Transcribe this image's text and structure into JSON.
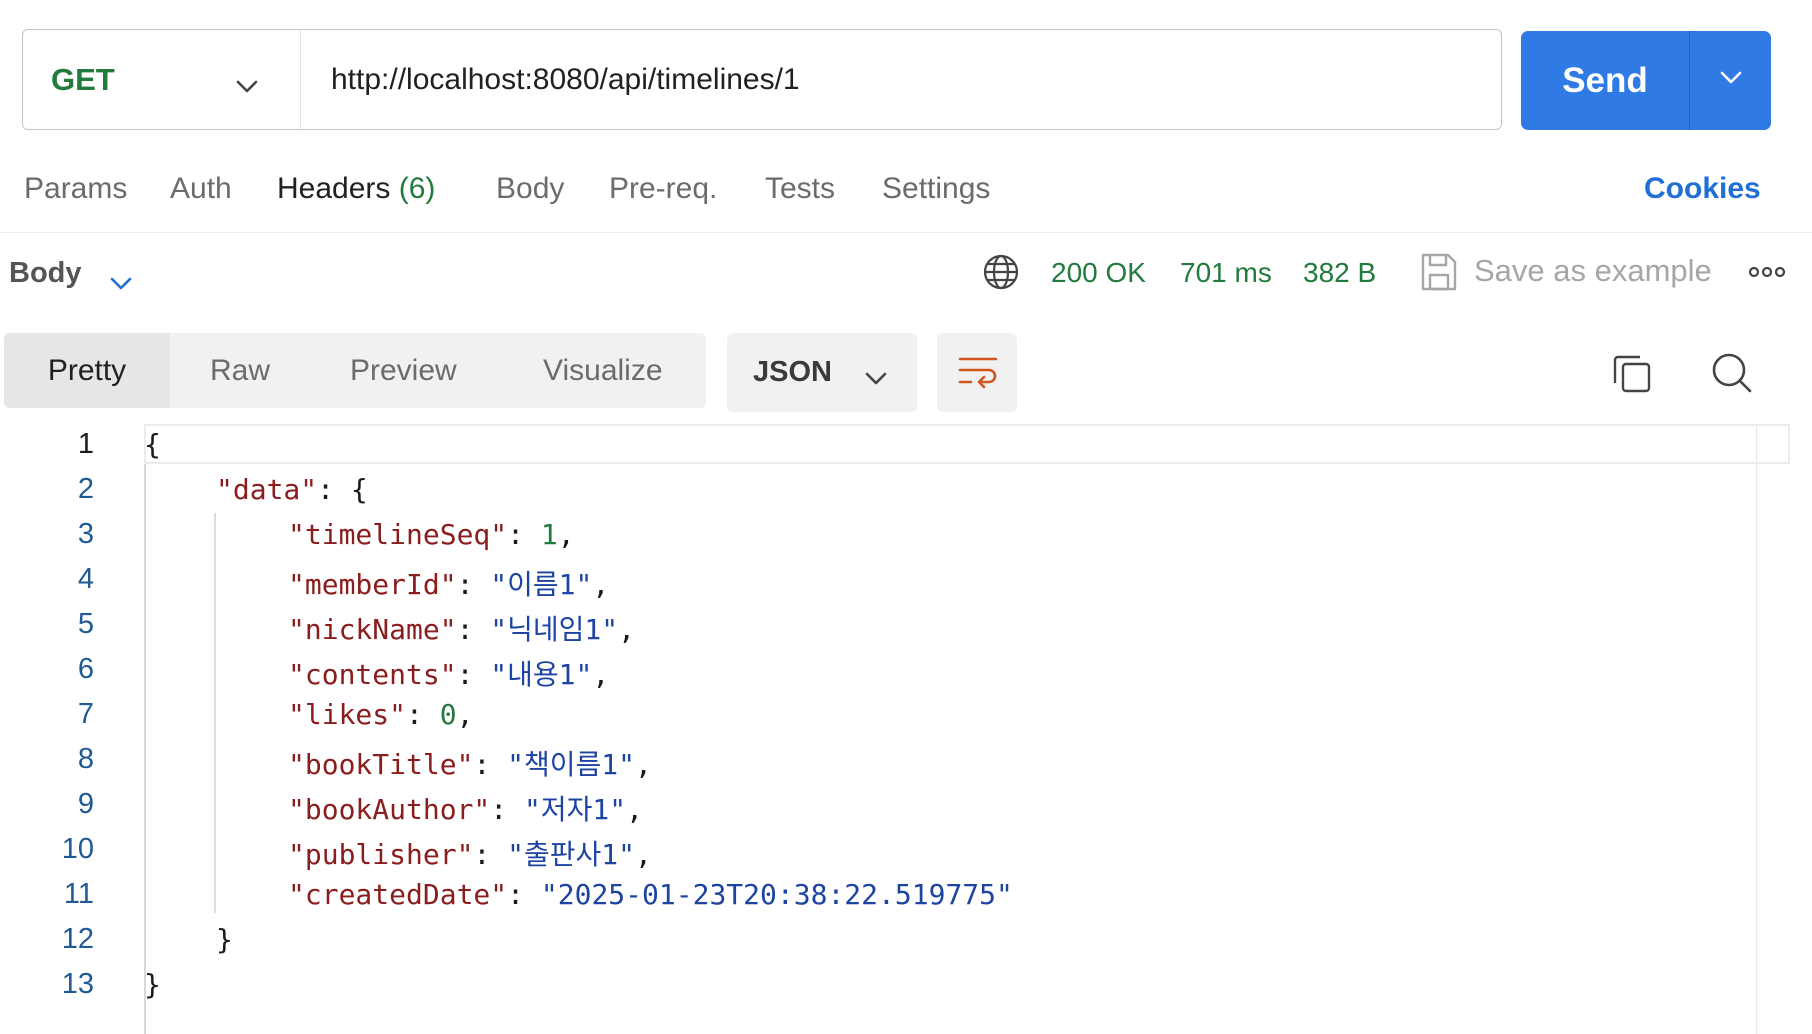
{
  "request": {
    "method": "GET",
    "url": "http://localhost:8080/api/timelines/1",
    "send_label": "Send"
  },
  "tabs": {
    "params": "Params",
    "auth": "Auth",
    "headers": "Headers",
    "headers_count": "(6)",
    "body": "Body",
    "prereq": "Pre-req.",
    "tests": "Tests",
    "settings": "Settings",
    "cookies": "Cookies"
  },
  "response": {
    "section_label": "Body",
    "status": "200 OK",
    "time": "701 ms",
    "size": "382 B",
    "save_example": "Save as example"
  },
  "view": {
    "pretty": "Pretty",
    "raw": "Raw",
    "preview": "Preview",
    "visualize": "Visualize",
    "format": "JSON"
  },
  "code": {
    "line_numbers": [
      "1",
      "2",
      "3",
      "4",
      "5",
      "6",
      "7",
      "8",
      "9",
      "10",
      "11",
      "12",
      "13"
    ],
    "open_brace": "{",
    "data_key": "\"data\"",
    "data_open": ": {",
    "fields": [
      {
        "key": "\"timelineSeq\"",
        "value": "1",
        "type": "number",
        "trail": ","
      },
      {
        "key": "\"memberId\"",
        "value": "\"이름1\"",
        "type": "string",
        "trail": ","
      },
      {
        "key": "\"nickName\"",
        "value": "\"닉네임1\"",
        "type": "string",
        "trail": ","
      },
      {
        "key": "\"contents\"",
        "value": "\"내용1\"",
        "type": "string",
        "trail": ","
      },
      {
        "key": "\"likes\"",
        "value": "0",
        "type": "number",
        "trail": ","
      },
      {
        "key": "\"bookTitle\"",
        "value": "\"책이름1\"",
        "type": "string",
        "trail": ","
      },
      {
        "key": "\"bookAuthor\"",
        "value": "\"저자1\"",
        "type": "string",
        "trail": ","
      },
      {
        "key": "\"publisher\"",
        "value": "\"출판사1\"",
        "type": "string",
        "trail": ","
      },
      {
        "key": "\"createdDate\"",
        "value": "\"2025-01-23T20:38:22.519775\"",
        "type": "string",
        "trail": ""
      }
    ],
    "inner_close": "}",
    "outer_close": "}"
  },
  "icons": {
    "method_dropdown": "chevron-down-icon",
    "send_dropdown": "chevron-down-icon",
    "body_dropdown": "chevron-down-icon",
    "network": "globe-icon",
    "save": "save-icon",
    "more": "more-icon",
    "wrap": "wrap-lines-icon",
    "copy": "copy-icon",
    "search": "search-icon"
  },
  "colors": {
    "send_button": "#2f7ae5",
    "method_get": "#227a3d",
    "status_ok": "#227a3d",
    "cookies_link": "#1f6fd6",
    "json_key": "#8a1d1d",
    "json_string": "#1d44a3",
    "json_number": "#227a3d",
    "wrap_icon": "#d2541f"
  }
}
